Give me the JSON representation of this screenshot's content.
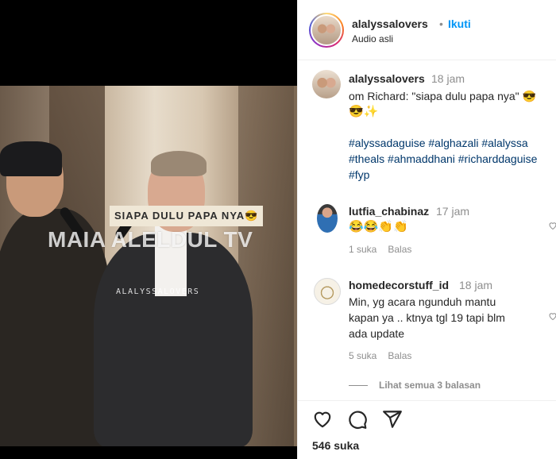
{
  "video": {
    "subtitle": "SIAPA DULU PAPA NYA😎",
    "watermark": "MAIA ALELDUL TV",
    "small_watermark": "ALALYSSALOVERS"
  },
  "header": {
    "username": "alalyssalovers",
    "separator": "•",
    "follow_label": "Ikuti",
    "audio_label": "Audio asli"
  },
  "caption": {
    "username": "alalyssalovers",
    "time": "18 jam",
    "text": "om Richard: \"siapa dulu papa nya\" 😎",
    "emoji_line": "😎✨",
    "hashtags": [
      "#alyssadaguise #alghazali #alalyssa",
      "#theals #ahmaddhani #richarddaguise",
      "#fyp"
    ]
  },
  "comments": [
    {
      "username": "lutfia_chabinaz",
      "time": "17 jam",
      "text": "😂😂👏👏",
      "likes": "1 suka",
      "reply_label": "Balas"
    },
    {
      "username": "homedecorstuff_id",
      "time": "18 jam",
      "text_lines": [
        "Min, yg acara ngunduh mantu",
        "kapan ya .. ktnya tgl 19 tapi blm",
        "ada update"
      ],
      "likes": "5 suka",
      "reply_label": "Balas",
      "view_replies": "Lihat semua 3 balasan"
    }
  ],
  "footer": {
    "likes": "546 suka"
  },
  "icons": {
    "like": "heart-icon",
    "comment": "comment-icon",
    "share": "share-icon",
    "comment_like": "heart-icon"
  },
  "colors": {
    "link": "#00376b",
    "follow": "#0095f6",
    "muted": "#8e8e8e"
  }
}
